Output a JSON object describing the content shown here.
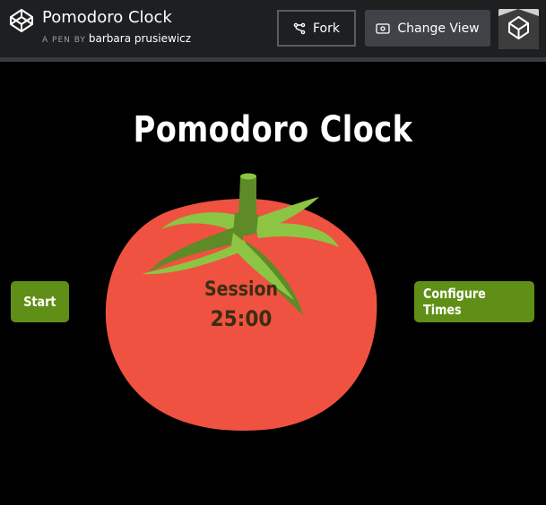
{
  "header": {
    "pen_title": "Pomodoro Clock",
    "pen_by_prefix": "A PEN BY",
    "author": "barbara prusiewicz",
    "fork_label": "Fork",
    "change_view_label": "Change View",
    "logo_icon": "codepen-logo-icon",
    "fork_icon": "fork-icon",
    "view_icon": "eye-icon"
  },
  "main": {
    "title": "Pomodoro Clock",
    "session_label": "Session",
    "session_time": "25:00",
    "start_label": "Start",
    "configure_label": "Configure Times"
  },
  "colors": {
    "background": "#000000",
    "header_bg": "#1e1f21",
    "tomato": "#ef5240",
    "leaf_dark": "#5e8a27",
    "leaf_light": "#8cc544",
    "button_green": "#5f8f16",
    "timer_text": "#3a2e12"
  }
}
